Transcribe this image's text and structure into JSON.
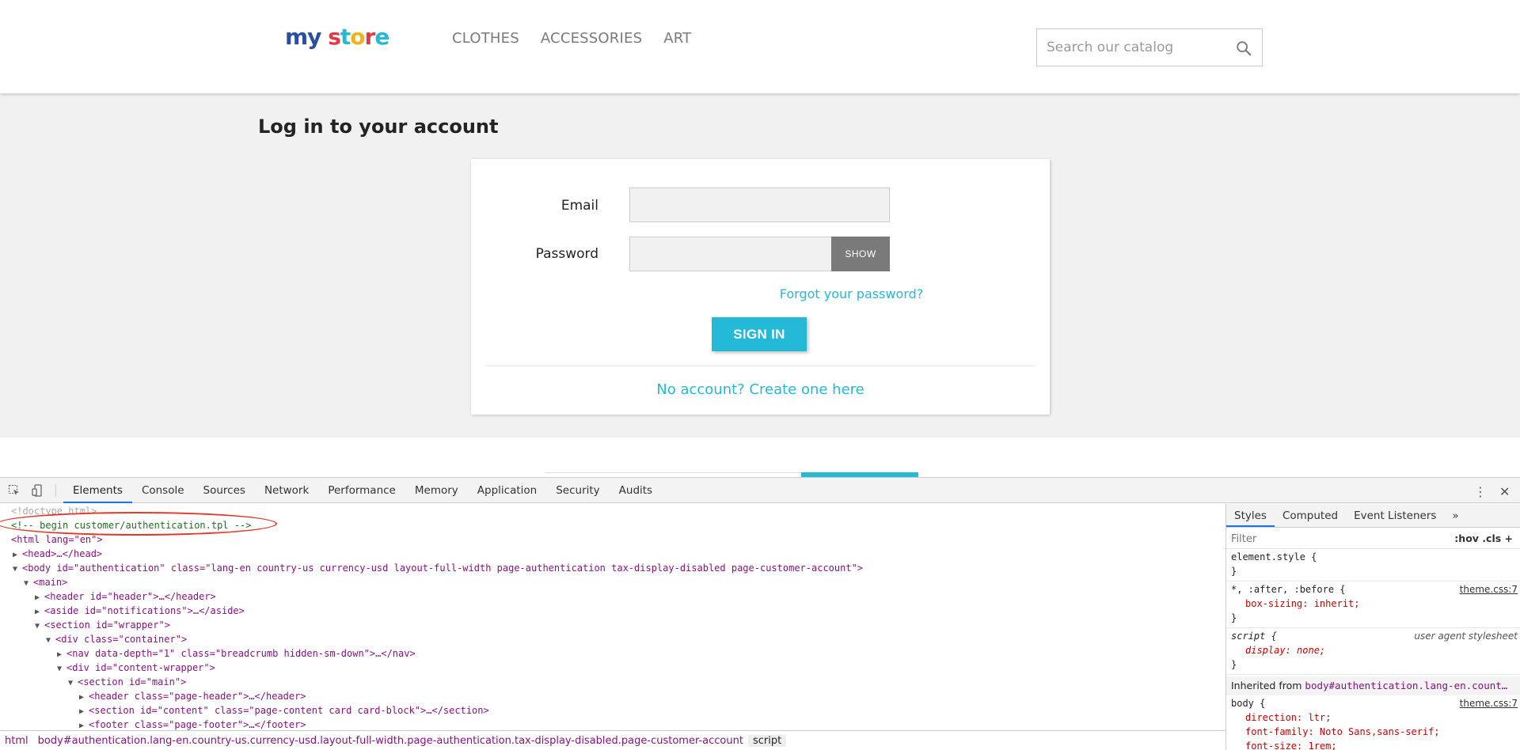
{
  "store": {
    "logo_text": "my store",
    "nav": [
      "CLOTHES",
      "ACCESSORIES",
      "ART"
    ],
    "search": {
      "placeholder": "Search our catalog",
      "icon": "search-icon"
    }
  },
  "login": {
    "page_title": "Log in to your account",
    "email_label": "Email",
    "password_label": "Password",
    "show_button": "SHOW",
    "forgot_link": "Forgot your password?",
    "signin_button": "SIGN IN",
    "create_link": "No account? Create one here"
  },
  "devtools": {
    "tabs": [
      "Elements",
      "Console",
      "Sources",
      "Network",
      "Performance",
      "Memory",
      "Application",
      "Security",
      "Audits"
    ],
    "active_tab": "Elements",
    "dom_lines": [
      {
        "type": "faded",
        "text": "<!doctype html>"
      },
      {
        "type": "comment",
        "text": "<!-- begin customer/authentication.tpl -->"
      },
      {
        "type": "raw",
        "text": "<html lang=\"en\">"
      },
      {
        "type": "raw",
        "text": "<head>…</head>"
      },
      {
        "type": "raw",
        "text": "<body id=\"authentication\" class=\"lang-en country-us currency-usd layout-full-width page-authentication tax-display-disabled page-customer-account\">"
      },
      {
        "type": "raw",
        "text": "<main>"
      },
      {
        "type": "raw",
        "text": "<header id=\"header\">…</header>"
      },
      {
        "type": "raw",
        "text": "<aside id=\"notifications\">…</aside>"
      },
      {
        "type": "raw",
        "text": "<section id=\"wrapper\">"
      },
      {
        "type": "raw",
        "text": "<div class=\"container\">"
      },
      {
        "type": "raw",
        "text": "<nav data-depth=\"1\" class=\"breadcrumb hidden-sm-down\">…</nav>"
      },
      {
        "type": "raw",
        "text": "<div id=\"content-wrapper\">"
      },
      {
        "type": "raw",
        "text": "<section id=\"main\">"
      },
      {
        "type": "raw",
        "text": "<header class=\"page-header\">…</header>"
      },
      {
        "type": "raw",
        "text": "<section id=\"content\" class=\"page-content card card-block\">…</section>"
      },
      {
        "type": "raw",
        "text": "<footer class=\"page-footer\">…</footer>"
      }
    ],
    "breadcrumb": [
      "html",
      "body#authentication.lang-en.country-us.currency-usd.layout-full-width.page-authentication.tax-display-disabled.page-customer-account",
      "script"
    ],
    "styles": {
      "tabs": [
        "Styles",
        "Computed",
        "Event Listeners",
        "»"
      ],
      "filter_placeholder": "Filter",
      "filter_opts": ":hov  .cls  +",
      "element_style": "element.style {",
      "close_brace": "}",
      "rule1_selector": "*, :after, :before {",
      "rule1_source": "theme.css:7",
      "rule1_prop": "box-sizing: inherit;",
      "rule2_selector": "script {",
      "rule2_source": "user agent stylesheet",
      "rule2_prop": "display: none;",
      "inherited_label": "Inherited from",
      "inherited_from": "body#authentication.lang-en.count…",
      "rule3_selector": "body {",
      "rule3_source": "theme.css:7",
      "rule3_props": [
        "direction: ltr;",
        "font-family: Noto Sans,sans-serif;",
        "font-size: 1rem;"
      ]
    }
  }
}
